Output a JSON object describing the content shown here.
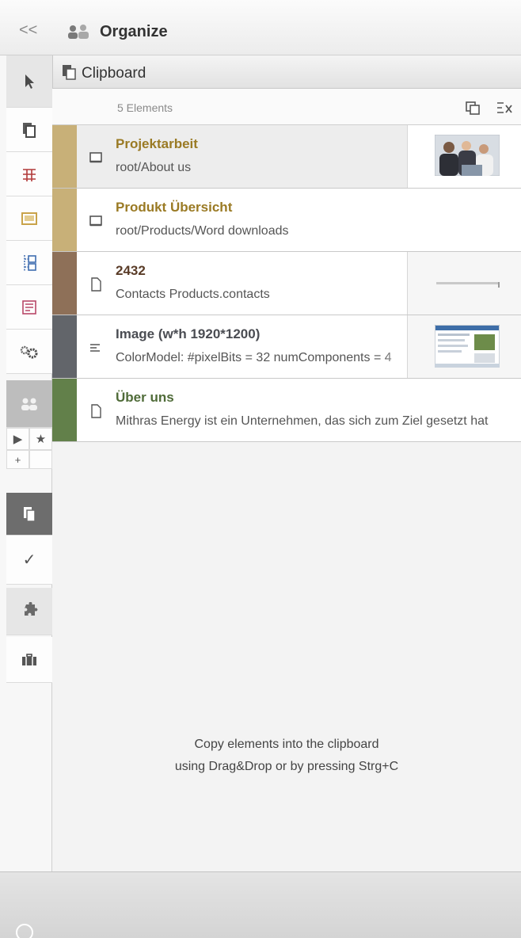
{
  "header": {
    "collapse_glyph": "<<",
    "title": "Organize",
    "icon": "users-group-icon"
  },
  "toolbar": {
    "items": [
      {
        "name": "select-tool",
        "icon": "cursor-arrow-icon"
      },
      {
        "name": "pages-tool",
        "icon": "pages-stack-icon"
      },
      {
        "name": "table-tool",
        "icon": "table-grid-icon"
      },
      {
        "name": "media-tool",
        "icon": "media-box-icon"
      },
      {
        "name": "sitemap-tool",
        "icon": "tree-structure-icon"
      },
      {
        "name": "forms-tool",
        "icon": "form-list-icon"
      },
      {
        "name": "settings-tool",
        "icon": "gears-icon"
      },
      {
        "name": "organize-tool",
        "icon": "users-group-icon"
      },
      {
        "name": "clipboard-tool",
        "icon": "clipboard-icon"
      },
      {
        "name": "tasks-tool",
        "icon": "check-icon"
      },
      {
        "name": "plugins-tool",
        "icon": "puzzle-icon"
      },
      {
        "name": "toolbox-tool",
        "icon": "briefcase-icon"
      }
    ],
    "mini": {
      "play_glyph": "▶",
      "star_glyph": "★",
      "plus_glyph": "+"
    },
    "check_glyph": "✓"
  },
  "clipboard": {
    "title": "Clipboard",
    "count_label": "5 Elements",
    "items": [
      {
        "title": "Projektarbeit",
        "subtitle": "root/About us",
        "color": "#c8b078",
        "title_color": "#9a7a24",
        "type_icon": "page-icon",
        "thumb": "people-photo"
      },
      {
        "title": "Produkt Übersicht",
        "subtitle": "root/Products/Word downloads",
        "color": "#c8b078",
        "title_color": "#9a7a24",
        "type_icon": "page-icon",
        "thumb": null
      },
      {
        "title": "2432",
        "subtitle": "Contacts Products.contacts",
        "color": "#8e7058",
        "title_color": "#5a3c28",
        "type_icon": "document-icon",
        "thumb": "line-preview"
      },
      {
        "title": "Image (w*h 1920*1200)",
        "subtitle": "ColorModel: #pixelBits = 32 numComponents = 4",
        "color": "#62656a",
        "title_color": "#4a4c52",
        "type_icon": "lines-icon",
        "thumb": "screenshot-preview"
      },
      {
        "title": "Über uns",
        "subtitle": "Mithras Energy ist ein Unternehmen, das sich zum Ziel gesetzt hat",
        "color": "#62804a",
        "title_color": "#4f6b38",
        "type_icon": "document-icon",
        "thumb": null
      }
    ],
    "hint": {
      "line1": "Copy elements into the clipboard",
      "line2": "using Drag&Drop or by pressing Strg+C"
    }
  },
  "colors": {
    "accent_gold": "#9a7a24",
    "toolbar_active": "#6d6d6d"
  }
}
